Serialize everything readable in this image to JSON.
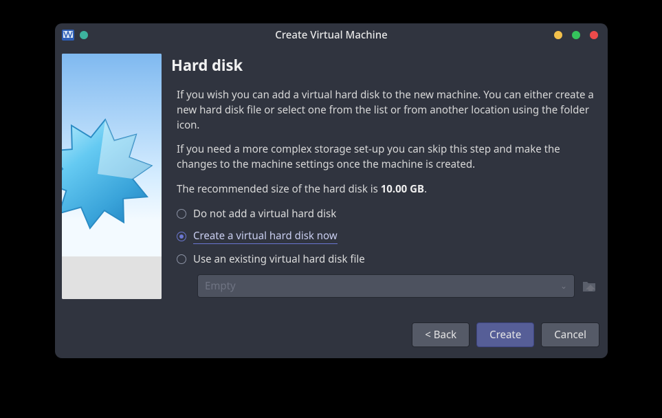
{
  "window": {
    "title": "Create Virtual Machine"
  },
  "page": {
    "heading": "Hard disk",
    "para1": "If you wish you can add a virtual hard disk to the new machine. You can either create a new hard disk file or select one from the list or from another location using the folder icon.",
    "para2": "If you need a more complex storage set-up you can skip this step and make the changes to the machine settings once the machine is created.",
    "para3_prefix": "The recommended size of the hard disk is ",
    "recommended_size": "10.00 GB",
    "para3_suffix": "."
  },
  "options": {
    "no_disk": {
      "label": "Do not add a virtual hard disk",
      "selected": false
    },
    "create_disk": {
      "label": "Create a virtual hard disk now",
      "selected": true
    },
    "existing_disk": {
      "label": "Use an existing virtual hard disk file",
      "selected": false
    }
  },
  "existing": {
    "combo_value": "Empty",
    "enabled": false
  },
  "buttons": {
    "back": "< Back",
    "create": "Create",
    "cancel": "Cancel"
  }
}
